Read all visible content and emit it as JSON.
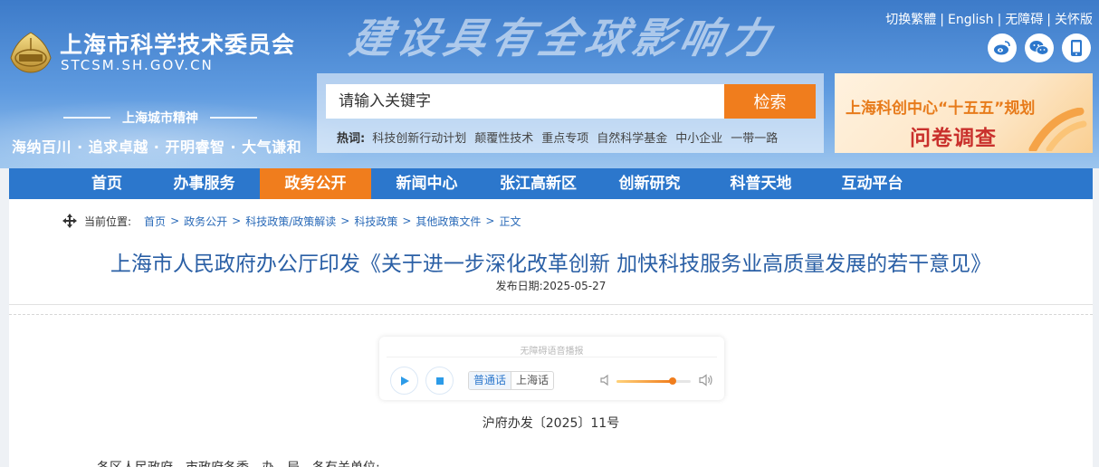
{
  "header": {
    "site_name": "上海市科学技术委员会",
    "site_domain": "STCSM.SH.GOV.CN",
    "calligraphy": "建设具有全球影响力",
    "spirit_title": "上海城市精神",
    "spirit_text": "海纳百川 · 追求卓越 · 开明睿智 · 大气谦和",
    "top_links": [
      "切换繁體",
      "English",
      "无障碍",
      "关怀版"
    ],
    "top_link_separator": "|"
  },
  "search": {
    "placeholder": "请输入关键字",
    "button_label": "检索",
    "hot_label": "热词:",
    "hot_words": [
      "科技创新行动计划",
      "颠覆性技术",
      "重点专项",
      "自然科学基金",
      "中小企业",
      "一带一路"
    ]
  },
  "banner": {
    "line1": "上海科创中心“十五五”规划",
    "line2": "问卷调查"
  },
  "nav": {
    "items": [
      "首页",
      "办事服务",
      "政务公开",
      "新闻中心",
      "张江高新区",
      "创新研究",
      "科普天地",
      "互动平台"
    ],
    "active_index": 2
  },
  "breadcrumb": {
    "label": "当前位置:",
    "items": [
      "首页",
      "政务公开",
      "科技政策/政策解读",
      "科技政策",
      "其他政策文件",
      "正文"
    ],
    "separator": ">"
  },
  "article": {
    "title": "上海市人民政府办公厅印发《关于进一步深化改革创新 加快科技服务业高质量发展的若干意见》",
    "publish_date": "发布日期:2025-05-27",
    "doc_number": "沪府办发〔2025〕11号",
    "addressee": "各区人民政府，市政府各委、办、局，各有关单位:"
  },
  "player": {
    "caption": "无障碍语音播报",
    "languages": [
      "普通话",
      "上海话"
    ],
    "active_language": 0,
    "volume": 0.75
  },
  "colors": {
    "header_blue": "#3d7bc9",
    "nav_blue": "#2c77cc",
    "accent_orange": "#f07d1d",
    "title_blue": "#2a5fa5"
  }
}
